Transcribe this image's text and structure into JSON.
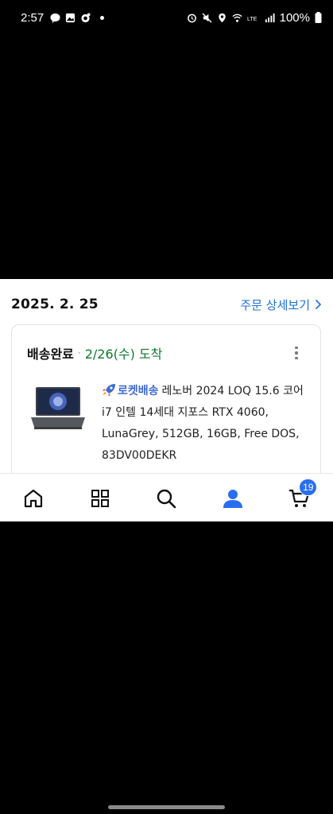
{
  "status_bar": {
    "time": "2:57",
    "battery": "100%",
    "left_icons": [
      "talk-icon",
      "gallery-icon",
      "settings-icon",
      "dot-icon"
    ],
    "right_icons": [
      "alarm-icon",
      "mute-icon",
      "location-icon",
      "wifi-icon",
      "lte-icon",
      "signal-icon",
      "battery-icon"
    ]
  },
  "order": {
    "date": "2025. 2. 25",
    "detail_link": "주문 상세보기",
    "status_label": "배송완료",
    "separator": "·",
    "delivery_date": "2/26(수) 도착",
    "rocket_label": "로켓배송",
    "product_name": "레노버 2024 LOQ 15.6 코어 i7 인텔 14세대 지포스 RTX 4060, LunaGrey, 512GB, 16GB, Free DOS, 83DV00DEKR"
  },
  "bottom_nav": {
    "items": [
      "home-icon",
      "category-icon",
      "search-icon",
      "my-page-icon",
      "cart-icon"
    ],
    "active": "my-page-icon",
    "cart_count": "19"
  },
  "colors": {
    "accent": "#2a6ef0",
    "link": "#1a6fd8",
    "delivered": "#0d7a2d",
    "rocket": "#3d6bd1"
  }
}
